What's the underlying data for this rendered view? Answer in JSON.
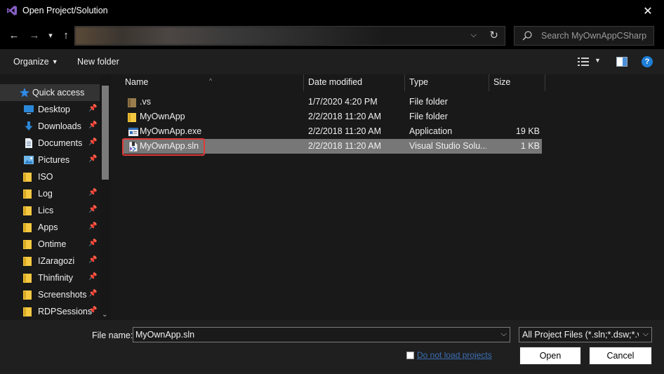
{
  "window": {
    "title": "Open Project/Solution",
    "close_glyph": "✕"
  },
  "navigation": {
    "back_glyph": "←",
    "forward_glyph": "→",
    "recent_glyph": "▾",
    "up_glyph": "↑",
    "address_dropdown_glyph": "⌵",
    "refresh_glyph": "↻",
    "search_placeholder": "Search MyOwnAppCSharp"
  },
  "toolbar": {
    "organize_label": "Organize",
    "organize_arrow": "▼",
    "new_folder_label": "New folder",
    "view_arrow": "▼",
    "help_label": "?"
  },
  "sidebar": {
    "quick_access": "Quick access",
    "pin_glyph": "📌",
    "scroll_down_glyph": "⌄",
    "items": [
      {
        "label": "Desktop",
        "icon": "desktop-icon"
      },
      {
        "label": "Downloads",
        "icon": "download-icon"
      },
      {
        "label": "Documents",
        "icon": "documents-icon"
      },
      {
        "label": "Pictures",
        "icon": "pictures-icon"
      },
      {
        "label": "ISO",
        "icon": "folder-icon"
      },
      {
        "label": "Log",
        "icon": "folder-icon"
      },
      {
        "label": "Lics",
        "icon": "folder-icon"
      },
      {
        "label": "Apps",
        "icon": "folder-icon"
      },
      {
        "label": "Ontime",
        "icon": "folder-icon"
      },
      {
        "label": "IZaragozi",
        "icon": "folder-icon"
      },
      {
        "label": "Thinfinity",
        "icon": "folder-icon"
      },
      {
        "label": "Screenshots",
        "icon": "folder-icon"
      },
      {
        "label": "RDPSessions",
        "icon": "folder-icon"
      }
    ]
  },
  "file_list": {
    "sort_glyph": "^",
    "columns": {
      "name": "Name",
      "date": "Date modified",
      "type": "Type",
      "size": "Size"
    },
    "rows": [
      {
        "name": ".vs",
        "date": "1/7/2020 4:20 PM",
        "type": "File folder",
        "size": "",
        "icon": "folder-icon"
      },
      {
        "name": "MyOwnApp",
        "date": "2/2/2018 11:20 AM",
        "type": "File folder",
        "size": "",
        "icon": "folder-icon"
      },
      {
        "name": "MyOwnApp.exe",
        "date": "2/2/2018 11:20 AM",
        "type": "Application",
        "size": "19 KB",
        "icon": "application-icon"
      },
      {
        "name": "MyOwnApp.sln",
        "date": "2/2/2018 11:20 AM",
        "type": "Visual Studio Solu...",
        "size": "1 KB",
        "icon": "solution-file-icon",
        "selected": true
      }
    ]
  },
  "bottom": {
    "file_name_label": "File name:",
    "file_name_value": "MyOwnApp.sln",
    "file_type_value": "All Project Files (*.sln;*.dsw;*.vc",
    "dropdown_glyph": "⌵",
    "do_not_load_label": "Do not load projects",
    "open_label": "Open",
    "cancel_label": "Cancel"
  },
  "colors": {
    "accent": "#1f7fd8",
    "vs_purple": "#865fc5",
    "highlight": "#e03a3a",
    "selection": "#777777"
  }
}
